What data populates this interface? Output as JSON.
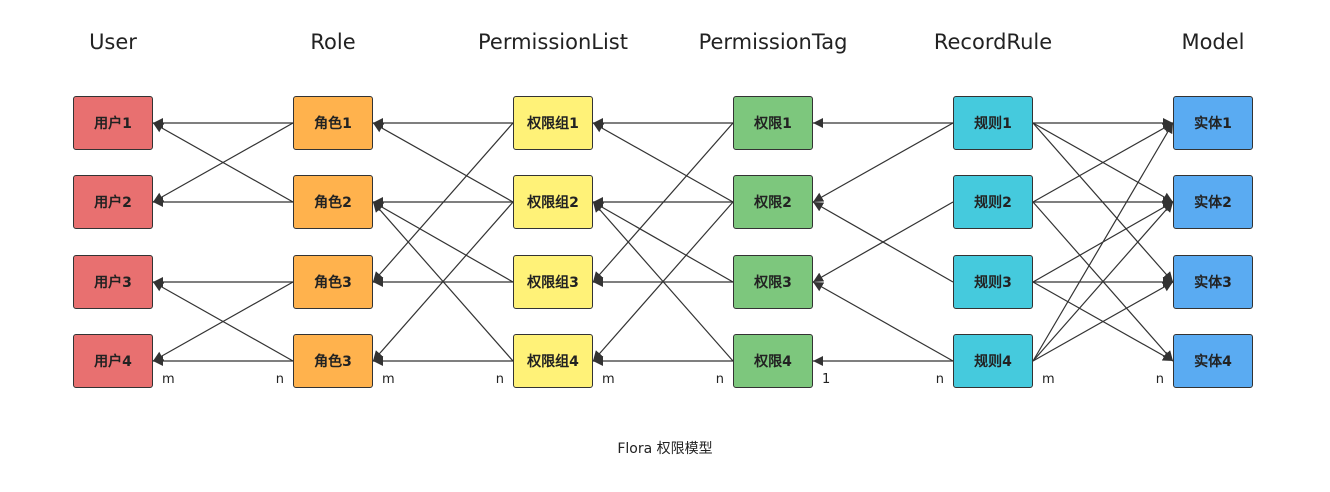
{
  "columns": [
    {
      "id": "user",
      "header": "User",
      "color": "#e87070",
      "nodes": [
        "用户1",
        "用户2",
        "用户3",
        "用户4"
      ]
    },
    {
      "id": "role",
      "header": "Role",
      "color": "#ffb24d",
      "nodes": [
        "角色1",
        "角色2",
        "角色3",
        "角色3"
      ]
    },
    {
      "id": "permission-list",
      "header": "PermissionList",
      "color": "#fff278",
      "nodes": [
        "权限组1",
        "权限组2",
        "权限组3",
        "权限组4"
      ]
    },
    {
      "id": "permission-tag",
      "header": "PermissionTag",
      "color": "#7dc77d",
      "nodes": [
        "权限1",
        "权限2",
        "权限3",
        "权限4"
      ]
    },
    {
      "id": "record-rule",
      "header": "RecordRule",
      "color": "#45cadd",
      "nodes": [
        "规则1",
        "规则2",
        "规则3",
        "规则4"
      ]
    },
    {
      "id": "model",
      "header": "Model",
      "color": "#5aabf2",
      "nodes": [
        "实体1",
        "实体2",
        "实体3",
        "实体4"
      ]
    }
  ],
  "multiplicities": [
    "m",
    "n",
    "m",
    "n",
    "m",
    "n",
    "1",
    "n",
    "m",
    "n"
  ],
  "edges": [
    {
      "from": [
        "role",
        0
      ],
      "to": [
        "user",
        0
      ]
    },
    {
      "from": [
        "role",
        0
      ],
      "to": [
        "user",
        1
      ]
    },
    {
      "from": [
        "role",
        1
      ],
      "to": [
        "user",
        0
      ]
    },
    {
      "from": [
        "role",
        1
      ],
      "to": [
        "user",
        1
      ]
    },
    {
      "from": [
        "role",
        2
      ],
      "to": [
        "user",
        2
      ]
    },
    {
      "from": [
        "role",
        2
      ],
      "to": [
        "user",
        3
      ]
    },
    {
      "from": [
        "role",
        3
      ],
      "to": [
        "user",
        2
      ]
    },
    {
      "from": [
        "role",
        3
      ],
      "to": [
        "user",
        3
      ]
    },
    {
      "from": [
        "permission-list",
        0
      ],
      "to": [
        "role",
        0
      ]
    },
    {
      "from": [
        "permission-list",
        0
      ],
      "to": [
        "role",
        2
      ]
    },
    {
      "from": [
        "permission-list",
        1
      ],
      "to": [
        "role",
        0
      ]
    },
    {
      "from": [
        "permission-list",
        1
      ],
      "to": [
        "role",
        1
      ]
    },
    {
      "from": [
        "permission-list",
        1
      ],
      "to": [
        "role",
        3
      ]
    },
    {
      "from": [
        "permission-list",
        2
      ],
      "to": [
        "role",
        1
      ]
    },
    {
      "from": [
        "permission-list",
        2
      ],
      "to": [
        "role",
        2
      ]
    },
    {
      "from": [
        "permission-list",
        3
      ],
      "to": [
        "role",
        1
      ]
    },
    {
      "from": [
        "permission-list",
        3
      ],
      "to": [
        "role",
        3
      ]
    },
    {
      "from": [
        "permission-tag",
        0
      ],
      "to": [
        "permission-list",
        0
      ]
    },
    {
      "from": [
        "permission-tag",
        0
      ],
      "to": [
        "permission-list",
        2
      ]
    },
    {
      "from": [
        "permission-tag",
        1
      ],
      "to": [
        "permission-list",
        0
      ]
    },
    {
      "from": [
        "permission-tag",
        1
      ],
      "to": [
        "permission-list",
        1
      ]
    },
    {
      "from": [
        "permission-tag",
        1
      ],
      "to": [
        "permission-list",
        3
      ]
    },
    {
      "from": [
        "permission-tag",
        2
      ],
      "to": [
        "permission-list",
        1
      ]
    },
    {
      "from": [
        "permission-tag",
        2
      ],
      "to": [
        "permission-list",
        2
      ]
    },
    {
      "from": [
        "permission-tag",
        3
      ],
      "to": [
        "permission-list",
        1
      ]
    },
    {
      "from": [
        "permission-tag",
        3
      ],
      "to": [
        "permission-list",
        3
      ]
    },
    {
      "from": [
        "record-rule",
        0
      ],
      "to": [
        "permission-tag",
        0
      ]
    },
    {
      "from": [
        "record-rule",
        0
      ],
      "to": [
        "permission-tag",
        1
      ]
    },
    {
      "from": [
        "record-rule",
        1
      ],
      "to": [
        "permission-tag",
        2
      ]
    },
    {
      "from": [
        "record-rule",
        2
      ],
      "to": [
        "permission-tag",
        1
      ]
    },
    {
      "from": [
        "record-rule",
        3
      ],
      "to": [
        "permission-tag",
        2
      ]
    },
    {
      "from": [
        "record-rule",
        3
      ],
      "to": [
        "permission-tag",
        3
      ]
    },
    {
      "from": [
        "record-rule",
        0
      ],
      "to": [
        "model",
        0
      ]
    },
    {
      "from": [
        "record-rule",
        0
      ],
      "to": [
        "model",
        1
      ]
    },
    {
      "from": [
        "record-rule",
        0
      ],
      "to": [
        "model",
        2
      ]
    },
    {
      "from": [
        "record-rule",
        1
      ],
      "to": [
        "model",
        0
      ]
    },
    {
      "from": [
        "record-rule",
        1
      ],
      "to": [
        "model",
        1
      ]
    },
    {
      "from": [
        "record-rule",
        1
      ],
      "to": [
        "model",
        3
      ]
    },
    {
      "from": [
        "record-rule",
        2
      ],
      "to": [
        "model",
        1
      ]
    },
    {
      "from": [
        "record-rule",
        2
      ],
      "to": [
        "model",
        2
      ]
    },
    {
      "from": [
        "record-rule",
        2
      ],
      "to": [
        "model",
        3
      ]
    },
    {
      "from": [
        "record-rule",
        3
      ],
      "to": [
        "model",
        0
      ]
    },
    {
      "from": [
        "record-rule",
        3
      ],
      "to": [
        "model",
        1
      ]
    },
    {
      "from": [
        "record-rule",
        3
      ],
      "to": [
        "model",
        2
      ]
    }
  ],
  "caption": "Flora 权限模型"
}
